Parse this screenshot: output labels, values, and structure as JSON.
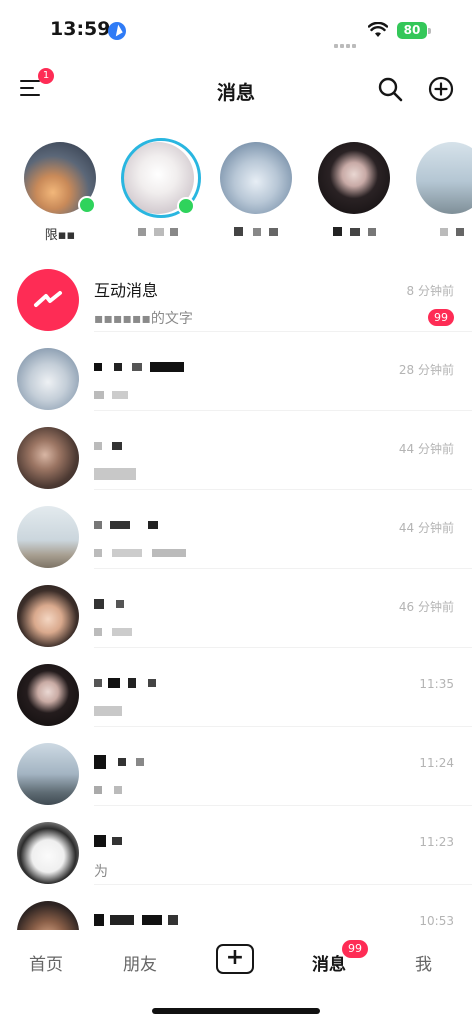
{
  "status_bar": {
    "time": "13:59",
    "battery": "80"
  },
  "header": {
    "title": "消息",
    "menu_badge": "1"
  },
  "stories": [
    {
      "name": "限▪▪",
      "online": true
    },
    {
      "name": "",
      "online": true,
      "ring": true
    },
    {
      "name": "",
      "online": false
    },
    {
      "name": "",
      "online": false
    },
    {
      "name": "",
      "online": false
    }
  ],
  "conversations": [
    {
      "name": "互动消息",
      "preview": "▪▪▪▪▪▪的文字",
      "time": "8 分钟前",
      "badge": "99"
    },
    {
      "name": "",
      "preview": "",
      "time": "28 分钟前"
    },
    {
      "name": "",
      "preview": "",
      "time": "44 分钟前"
    },
    {
      "name": "",
      "preview": "",
      "time": "44 分钟前"
    },
    {
      "name": "",
      "preview": "",
      "time": "46 分钟前"
    },
    {
      "name": "",
      "preview": "",
      "time": "11:35"
    },
    {
      "name": "",
      "preview": "",
      "time": "11:24"
    },
    {
      "name": "",
      "preview": "为",
      "time": "11:23"
    },
    {
      "name": "",
      "preview": "",
      "time": "10:53"
    }
  ],
  "tabbar": {
    "home": "首页",
    "friends": "朋友",
    "create": "+",
    "messages": "消息",
    "messages_badge": "99",
    "me": "我"
  },
  "colors": {
    "accent": "#fe2c55",
    "online": "#2fd35c",
    "ring": "#29b6e0"
  },
  "icons": [
    "menu-icon",
    "search-icon",
    "add-circle-icon",
    "location-arrow-icon",
    "wifi-icon",
    "battery-icon",
    "interaction-lightning-icon"
  ]
}
